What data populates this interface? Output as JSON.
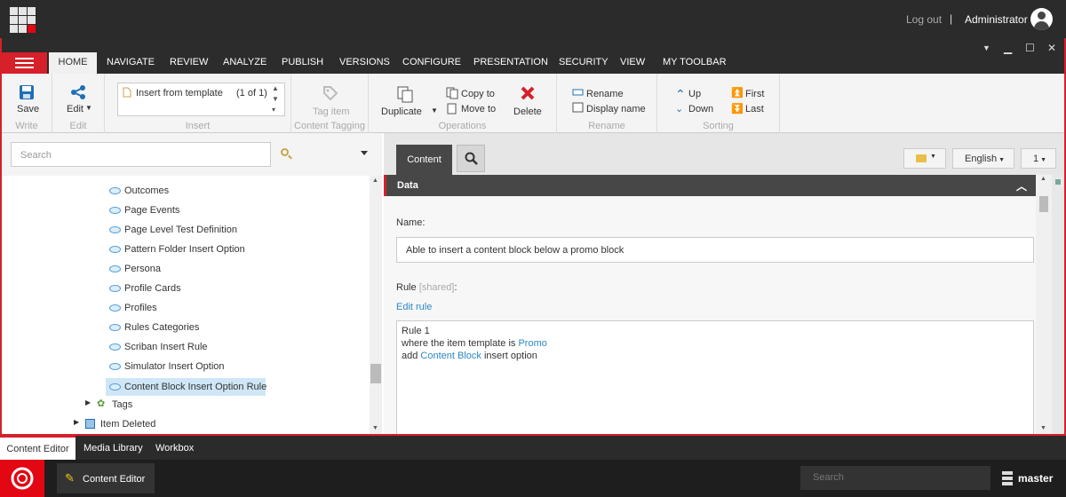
{
  "header": {
    "logout": "Log out",
    "separator": "|",
    "user": "Administrator"
  },
  "tabs": [
    "HOME",
    "NAVIGATE",
    "REVIEW",
    "ANALYZE",
    "PUBLISH",
    "VERSIONS",
    "CONFIGURE",
    "PRESENTATION",
    "SECURITY",
    "VIEW",
    "MY TOOLBAR"
  ],
  "ribbon": {
    "save": "Save",
    "write": "Write",
    "edit": "Edit",
    "edit_group": "Edit",
    "insert_item": "Insert from template",
    "insert_count": "(1 of 1)",
    "insert_group": "Insert",
    "tag_item": "Tag item",
    "tag_group": "Content Tagging",
    "duplicate": "Duplicate",
    "copy_to": "Copy to",
    "move_to": "Move to",
    "delete": "Delete",
    "operations": "Operations",
    "rename": "Rename",
    "display_name": "Display name",
    "rename_group": "Rename",
    "up": "Up",
    "down": "Down",
    "first": "First",
    "last": "Last",
    "sorting": "Sorting"
  },
  "left": {
    "search_placeholder": "Search",
    "tree": [
      "Outcomes",
      "Page Events",
      "Page Level Test Definition",
      "Pattern Folder Insert Option",
      "Persona",
      "Profile Cards",
      "Profiles",
      "Rules Categories",
      "Scriban Insert Rule",
      "Simulator Insert Option",
      "Content Block Insert Option Rule"
    ],
    "tags": "Tags",
    "item_deleted": "Item Deleted"
  },
  "right": {
    "content_tab": "Content",
    "language": "English",
    "version": "1",
    "section": "Data",
    "name_label": "Name:",
    "name_value": "Able to insert a content block below a promo block",
    "rule_label": "Rule",
    "rule_shared": "[shared]",
    "rule_colon": ":",
    "edit_rule": "Edit rule",
    "rule_line1": "Rule 1",
    "rule_line2_pre": "where the item template is",
    "rule_line2_link": "Promo",
    "rule_line3_pre": "add",
    "rule_line3_link": "Content Block",
    "rule_line3_post": "insert option"
  },
  "bottom_tabs": [
    "Content Editor",
    "Media Library",
    "Workbox"
  ],
  "taskbar": {
    "app": "Content Editor",
    "search_placeholder": "Search",
    "database": "master"
  }
}
